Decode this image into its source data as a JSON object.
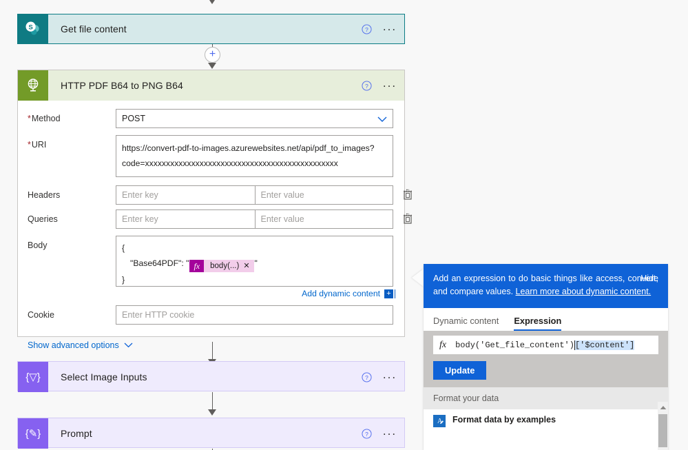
{
  "flow": {
    "actions": [
      {
        "id": "get-file-content",
        "title": "Get file content",
        "icon": "sharepoint-icon",
        "help": "?",
        "menu": "..."
      },
      {
        "id": "http-pdf-b64-to-png-b64",
        "title": "HTTP PDF B64 to PNG B64",
        "icon": "http-globe-icon",
        "help": "?",
        "menu": "..."
      },
      {
        "id": "select-image-inputs",
        "title": "Select Image Inputs",
        "icon": "select-braces-icon",
        "glyph": "{▽}",
        "help": "?",
        "menu": "..."
      },
      {
        "id": "prompt",
        "title": "Prompt",
        "icon": "compose-braces-icon",
        "glyph": "{✎}",
        "help": "?",
        "menu": "..."
      }
    ],
    "add_step_glyph": "+"
  },
  "http_form": {
    "method": {
      "label": "Method",
      "required_marker": "*",
      "value": "POST"
    },
    "uri": {
      "label": "URI",
      "required_marker": "*",
      "line1": "https://convert-pdf-to-images.azurewebsites.net/api/pdf_to_images?",
      "line2": "code=xxxxxxxxxxxxxxxxxxxxxxxxxxxxxxxxxxxxxxxxxxxxxx"
    },
    "headers": {
      "label": "Headers",
      "key_placeholder": "Enter key",
      "value_placeholder": "Enter value",
      "key_value": "",
      "value_value": "",
      "delete_icon": "trash-icon"
    },
    "queries": {
      "label": "Queries",
      "key_placeholder": "Enter key",
      "value_placeholder": "Enter value",
      "key_value": "",
      "value_value": "",
      "delete_icon": "trash-icon"
    },
    "body": {
      "label": "Body",
      "line1": "{",
      "line2_prefix": "\"Base64PDF\": \"",
      "token_fx": "fx",
      "token_text": "body(...)",
      "token_close": "✕",
      "line2_suffix": "\"",
      "line3": "}"
    },
    "add_dynamic_content": {
      "label": "Add dynamic content",
      "chip": "+"
    },
    "cookie": {
      "label": "Cookie",
      "placeholder": "Enter HTTP cookie",
      "value": ""
    },
    "advanced": {
      "label": "Show advanced options",
      "chevron": "chevron-down-icon"
    }
  },
  "expression_flyout": {
    "banner": {
      "text_before_link": "Add an expression to do basic things like access, convert, and compare values. ",
      "link_text": "Learn more about dynamic content.",
      "hide_label": "Hide"
    },
    "tabs": [
      {
        "label": "Dynamic content",
        "active": false
      },
      {
        "label": "Expression",
        "active": true
      }
    ],
    "editor": {
      "fx_symbol": "fx",
      "text": "body('Get_file_content')",
      "selected_text": "['$content']"
    },
    "update_button": "Update",
    "section_header": "Format your data",
    "items": [
      {
        "icon": "format-data-icon",
        "icon_glyph": "A",
        "title": "Format data by examples"
      }
    ],
    "scrollbar": {
      "up_arrow": "▲"
    }
  },
  "colors": {
    "sharepoint_teal": "#0f7b83",
    "sharepoint_card_bg": "#d6e9ea",
    "http_green": "#739b28",
    "http_card_bg": "#e7eedb",
    "purple": "#8661f0",
    "purple_card_bg": "#efebfd",
    "accent_blue": "#0f62d7",
    "link_blue": "#0066cc",
    "token_magenta": "#a4019b",
    "token_pink": "#f2cdea",
    "required_red": "#a4262c"
  }
}
